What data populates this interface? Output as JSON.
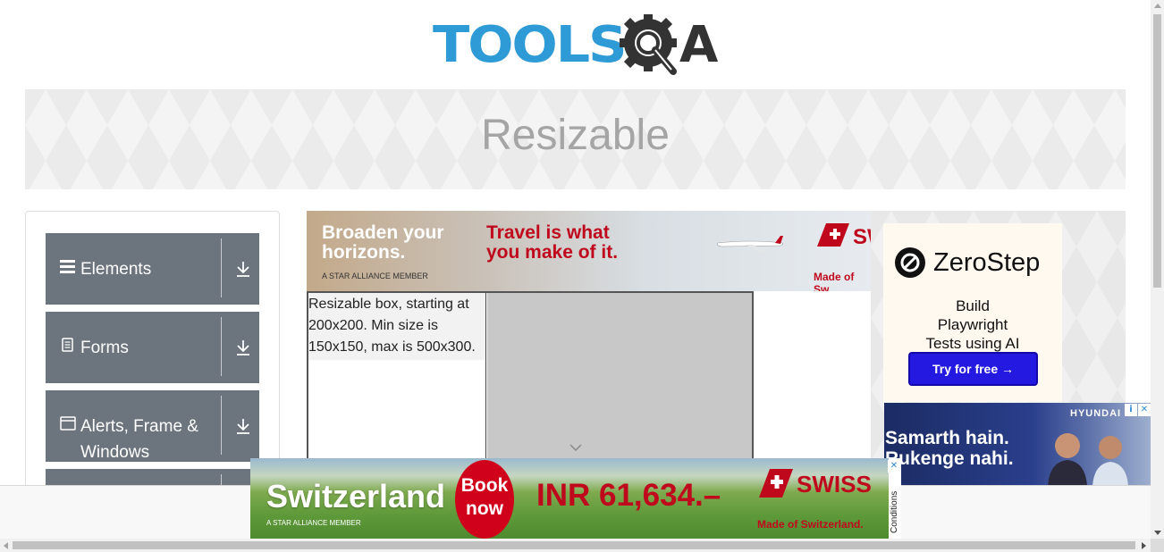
{
  "header": {
    "logo_text": "TOOLS",
    "logo_q": "Q",
    "logo_a": "A",
    "logo_color": "#2e9ad6"
  },
  "banner": {
    "title": "Resizable"
  },
  "sidebar": {
    "groups": [
      {
        "label": "Elements",
        "icon": "hamburger-icon"
      },
      {
        "label": "Forms",
        "icon": "document-icon"
      },
      {
        "label": "Alerts, Frame & Windows",
        "icon": "window-icon"
      },
      {
        "label": "",
        "icon": ""
      }
    ],
    "group_bg": "#6c757d"
  },
  "ad_top": {
    "left_line": "Broaden your horizons.",
    "alliance": "A STAR ALLIANCE MEMBER",
    "tagline": "Travel is what you make of it.",
    "brand": "SW",
    "made_of": "Made of Sw"
  },
  "resizable": {
    "text": "Resizable box, starting at 200x200. Min size is 150x150, max is 500x300."
  },
  "ad_right": {
    "brand": "ZeroStep",
    "subtitle": "Build Playwright Tests using AI",
    "button": "Try for free →",
    "button_color": "#2319e0"
  },
  "ad_hyundai": {
    "brand": "HYUNDAI",
    "slogan": "Samarth hain. Rukenge nahi."
  },
  "ad_bottom": {
    "destination": "Switzerland",
    "book": "Book now",
    "price": "INR 61,634.–",
    "brand": "SWISS",
    "alliance": "A STAR ALLIANCE MEMBER",
    "made_of": "Made of Switzerland.",
    "conditions": "Conditions",
    "brand_red": "#c0081d"
  }
}
